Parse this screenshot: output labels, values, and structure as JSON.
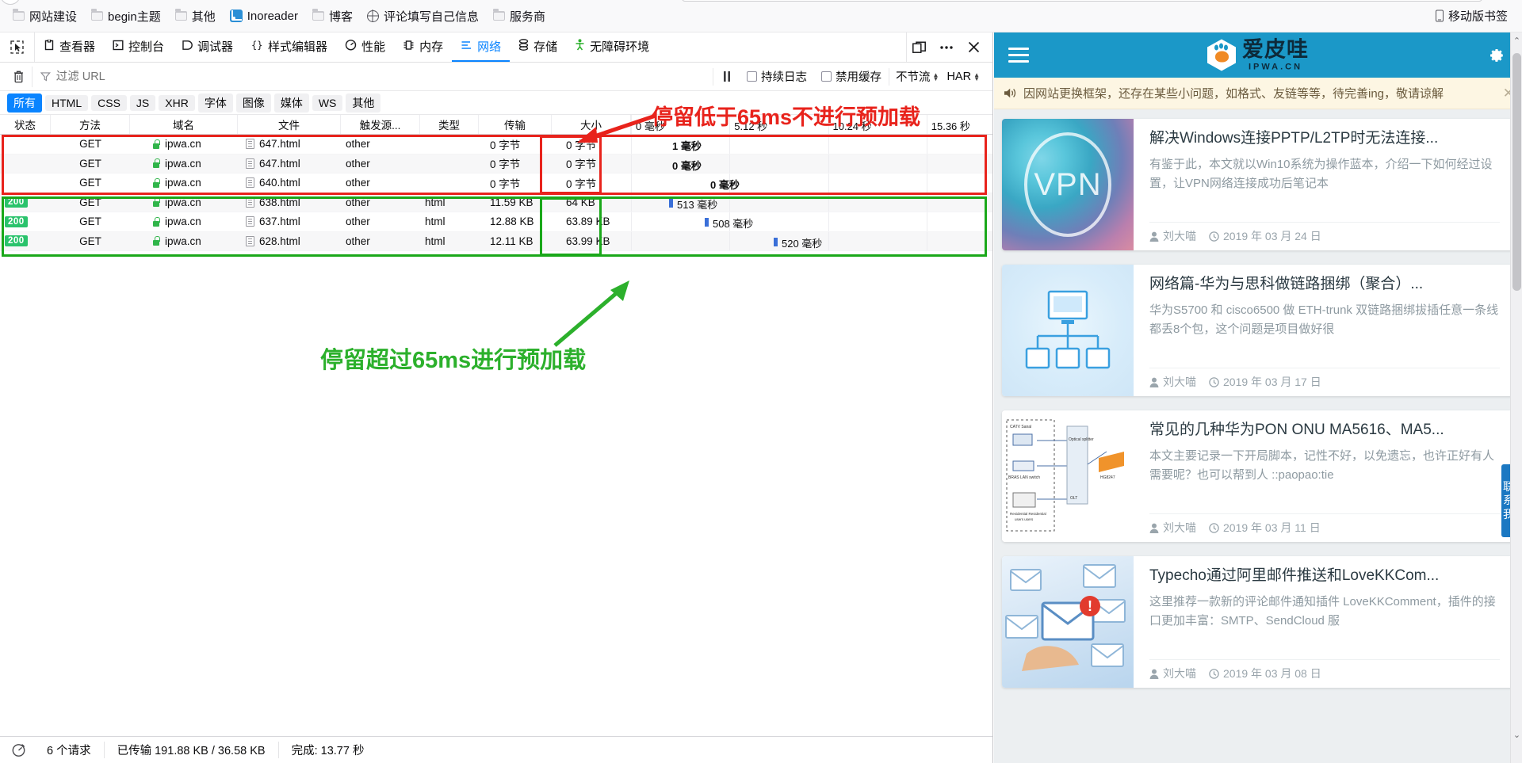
{
  "browser": {
    "bookmarks": [
      {
        "label": "网站建设",
        "icon": "folder-icon"
      },
      {
        "label": "begin主题",
        "icon": "folder-icon"
      },
      {
        "label": "其他",
        "icon": "folder-icon"
      },
      {
        "label": "Inoreader",
        "icon": "rss-icon"
      },
      {
        "label": "博客",
        "icon": "folder-icon"
      },
      {
        "label": "评论填写自己信息",
        "icon": "globe-icon"
      },
      {
        "label": "服务商",
        "icon": "folder-icon"
      }
    ],
    "mobile_bookmarks": "移动版书签"
  },
  "devtools": {
    "tabs": [
      {
        "label": "查看器",
        "icon": "inspector-icon",
        "active": false
      },
      {
        "label": "控制台",
        "icon": "console-icon",
        "active": false
      },
      {
        "label": "调试器",
        "icon": "debugger-icon",
        "active": false
      },
      {
        "label": "样式编辑器",
        "icon": "style-editor-icon",
        "active": false
      },
      {
        "label": "性能",
        "icon": "performance-icon",
        "active": false
      },
      {
        "label": "内存",
        "icon": "memory-icon",
        "active": false
      },
      {
        "label": "网络",
        "icon": "network-icon",
        "active": true
      },
      {
        "label": "存储",
        "icon": "storage-icon",
        "active": false
      },
      {
        "label": "无障碍环境",
        "icon": "accessibility-icon",
        "active": false
      }
    ],
    "filterbar": {
      "filter_placeholder": "过滤 URL",
      "filter_value": "",
      "persist_logs": "持续日志",
      "disable_cache": "禁用缓存",
      "throttling": "不节流",
      "har": "HAR"
    },
    "type_filters": [
      {
        "label": "所有",
        "active": true
      },
      {
        "label": "HTML",
        "active": false
      },
      {
        "label": "CSS",
        "active": false
      },
      {
        "label": "JS",
        "active": false
      },
      {
        "label": "XHR",
        "active": false
      },
      {
        "label": "字体",
        "active": false
      },
      {
        "label": "图像",
        "active": false
      },
      {
        "label": "媒体",
        "active": false
      },
      {
        "label": "WS",
        "active": false
      },
      {
        "label": "其他",
        "active": false
      }
    ],
    "columns": {
      "status": "状态",
      "method": "方法",
      "domain": "域名",
      "file": "文件",
      "cause": "触发源...",
      "type": "类型",
      "transferred": "传输",
      "size": "大小"
    },
    "timeline_ticks": [
      "0 毫秒",
      "5.12 秒",
      "10.24 秒",
      "15.36 秒"
    ],
    "rows": [
      {
        "status": "",
        "method": "GET",
        "domain": "ipwa.cn",
        "file": "647.html",
        "cause": "other",
        "type": "",
        "transferred": "0 字节",
        "size": "0 字节",
        "wf_label": "1 毫秒",
        "wf_label_pos": 52,
        "wf_bar": false,
        "group": "red"
      },
      {
        "status": "",
        "method": "GET",
        "domain": "ipwa.cn",
        "file": "647.html",
        "cause": "other",
        "type": "",
        "transferred": "0 字节",
        "size": "0 字节",
        "wf_label": "0 毫秒",
        "wf_label_pos": 52,
        "wf_bar": false,
        "group": "red"
      },
      {
        "status": "",
        "method": "GET",
        "domain": "ipwa.cn",
        "file": "640.html",
        "cause": "other",
        "type": "",
        "transferred": "0 字节",
        "size": "0 字节",
        "wf_label": "0 毫秒",
        "wf_label_pos": 100,
        "wf_bar": false,
        "group": "red"
      },
      {
        "status": "200",
        "method": "GET",
        "domain": "ipwa.cn",
        "file": "638.html",
        "cause": "other",
        "type": "html",
        "transferred": "11.59 KB",
        "size": "64 KB",
        "wf_label": "513 毫秒",
        "wf_label_pos": 58,
        "wf_bar": true,
        "group": "green"
      },
      {
        "status": "200",
        "method": "GET",
        "domain": "ipwa.cn",
        "file": "637.html",
        "cause": "other",
        "type": "html",
        "transferred": "12.88 KB",
        "size": "63.89 KB",
        "wf_label": "508 毫秒",
        "wf_label_pos": 103,
        "wf_bar": true,
        "group": "green"
      },
      {
        "status": "200",
        "method": "GET",
        "domain": "ipwa.cn",
        "file": "628.html",
        "cause": "other",
        "type": "html",
        "transferred": "12.11 KB",
        "size": "63.99 KB",
        "wf_label": "520 毫秒",
        "wf_label_pos": 190,
        "wf_bar": true,
        "group": "green"
      }
    ],
    "annotations": {
      "red_text": "停留低于65ms不进行预加载",
      "green_text": "停留超过65ms进行预加载",
      "red_color": "#e8231c",
      "green_color": "#2cb02c"
    },
    "statusbar": {
      "requests": "6 个请求",
      "transferred": "已传输 191.88 KB / 36.58 KB",
      "finish": "完成: 13.77 秒"
    }
  },
  "site": {
    "header": {
      "menu_icon": "hamburger-icon",
      "logo_cn": "爱皮哇",
      "logo_en": "IPWA.CN",
      "settings_icon": "gear-icon",
      "brand_color": "#1b98c8"
    },
    "notice": {
      "text": "因网站更换框架，还存在某些小问题，如格式、友链等等，待完善ing，敬请谅解",
      "close": "✕"
    },
    "contact_tab": "联系我",
    "articles": [
      {
        "title": "解决Windows连接PPTP/L2TP时无法连接...",
        "excerpt": "有鉴于此，本文就以Win10系统为操作蓝本，介绍一下如何经过设置，让VPN网络连接成功后笔记本",
        "author": "刘大喵",
        "date": "2019 年 03 月 24 日",
        "thumb": "vpn-thumbnail"
      },
      {
        "title": "网络篇-华为与思科做链路捆绑（聚合）...",
        "excerpt": "华为S5700 和 cisco6500 做 ETH-trunk 双链路捆绑拔插任意一条线都丢8个包，这个问题是项目做好很",
        "author": "刘大喵",
        "date": "2019 年 03 月 17 日",
        "thumb": "network-topology-thumbnail"
      },
      {
        "title": "常见的几种华为PON ONU MA5616、MA5...",
        "excerpt": "本文主要记录一下开局脚本，记性不好，以免遗忘，也许正好有人需要呢？也可以帮到人 ::paopao:tie",
        "author": "刘大喵",
        "date": "2019 年 03 月 11 日",
        "thumb": "pon-diagram-thumbnail"
      },
      {
        "title": "Typecho通过阿里邮件推送和LoveKKCom...",
        "excerpt": "这里推荐一款新的评论邮件通知插件 LoveKKComment，插件的接口更加丰富：SMTP、SendCloud 服",
        "author": "刘大喵",
        "date": "2019 年 03 月 08 日",
        "thumb": "mail-envelopes-thumbnail"
      }
    ]
  }
}
